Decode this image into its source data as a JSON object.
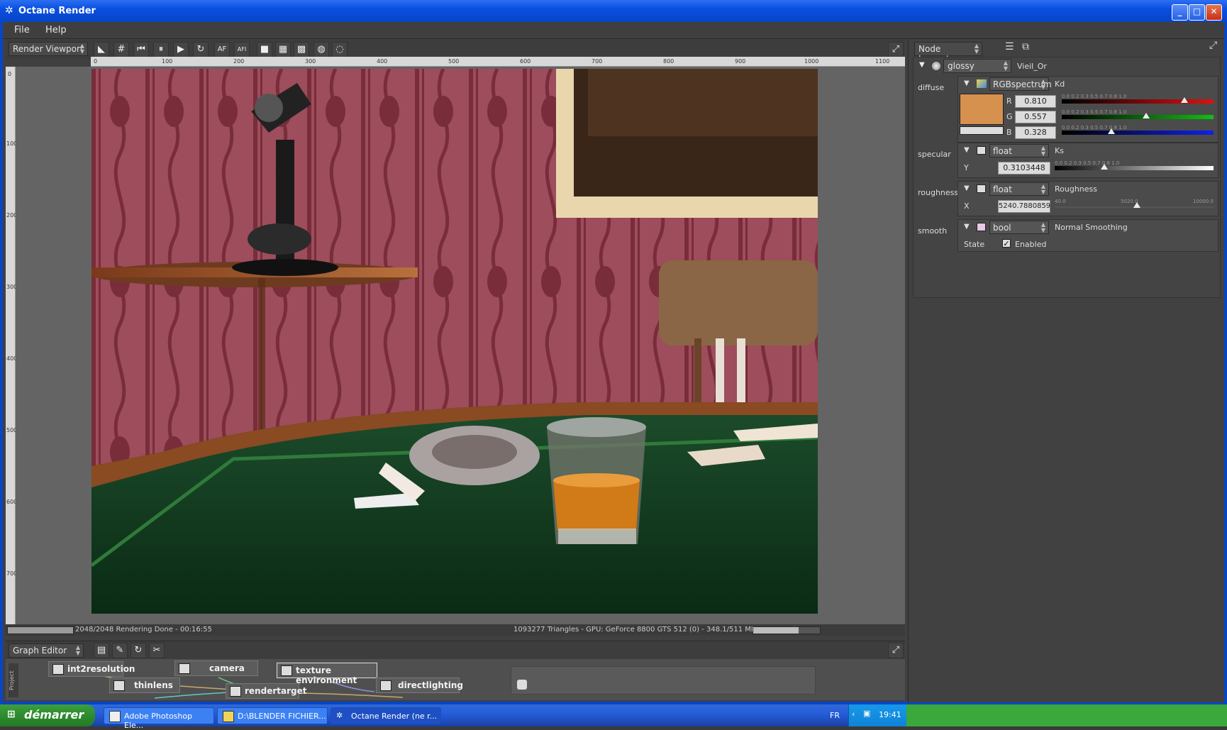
{
  "window": {
    "title": "Octane Render",
    "min": "_",
    "max": "□",
    "close": "✕"
  },
  "menu": [
    "File",
    "Help"
  ],
  "viewport": {
    "combo": "Render Viewport",
    "tools": [
      "◣",
      "#",
      "⏮",
      "⏸",
      "▶",
      "↻",
      "AF",
      "AFI",
      "■",
      "▦",
      "▩",
      "◍",
      "◌"
    ],
    "expand": "⤢",
    "ruler_h": [
      "0",
      "100",
      "200",
      "300",
      "400",
      "500",
      "600",
      "700",
      "800",
      "900",
      "1000",
      "1100"
    ],
    "ruler_v": [
      "0",
      "100",
      "200",
      "300",
      "400",
      "500",
      "600",
      "700"
    ],
    "status_left": "2048/2048 Rendering Done - 00:16:55",
    "status_right": "1093277 Triangles - GPU: GeForce 8800 GTS 512 (0) - 348.1/511 MB Mem Used",
    "progress_pct": 100,
    "mem_pct": 68
  },
  "graph": {
    "title": "Graph Editor",
    "tools": [
      "▤",
      "✎",
      "↻",
      "✂"
    ],
    "expand": "⤢",
    "side_tab": "Project",
    "nodes": [
      "int2resolution",
      "camera",
      "texture environment",
      "thinlens",
      "rendertarget",
      "directlighting"
    ]
  },
  "inspector": {
    "title": "Node Inspector",
    "icons": [
      "☰",
      "⧉"
    ],
    "expand": "⤢",
    "material": {
      "type": "glossy",
      "name": "Vieil_Or"
    },
    "diffuse": {
      "label": "diffuse",
      "type": "RGBspectrum",
      "param": "Kd",
      "color": "#d6914f",
      "r_label": "R",
      "g_label": "G",
      "b_label": "B",
      "r": "0.810",
      "g": "0.557",
      "b": "0.328",
      "r_val": 0.81,
      "g_val": 0.557,
      "b_val": 0.328,
      "scale": [
        "0.0",
        "0.2",
        "0.3",
        "0.5",
        "0.7",
        "0.8",
        "1.0"
      ]
    },
    "specular": {
      "label": "specular",
      "type": "float",
      "param": "Ks",
      "axis": "Y",
      "value": "0.3103448",
      "val": 0.3103448,
      "scale": [
        "0.0",
        "0.2",
        "0.3",
        "0.5",
        "0.7",
        "0.8",
        "1.0"
      ]
    },
    "roughness": {
      "label": "roughness",
      "type": "float",
      "param": "Roughness",
      "axis": "X",
      "value": "5240.7880859",
      "val": 0.52,
      "scale": [
        "40.0",
        "5020.0",
        "10000.0"
      ]
    },
    "smooth": {
      "label": "smooth",
      "type": "bool",
      "param": "Normal Smoothing",
      "state_label": "State",
      "enabled_label": "Enabled"
    }
  },
  "taskbar": {
    "start": "démarrer",
    "tasks": [
      "Adobe Photoshop Ele...",
      "D:\\BLENDER FICHIER...",
      "Octane Render (ne r..."
    ],
    "lang": "FR",
    "time": "19:41"
  }
}
